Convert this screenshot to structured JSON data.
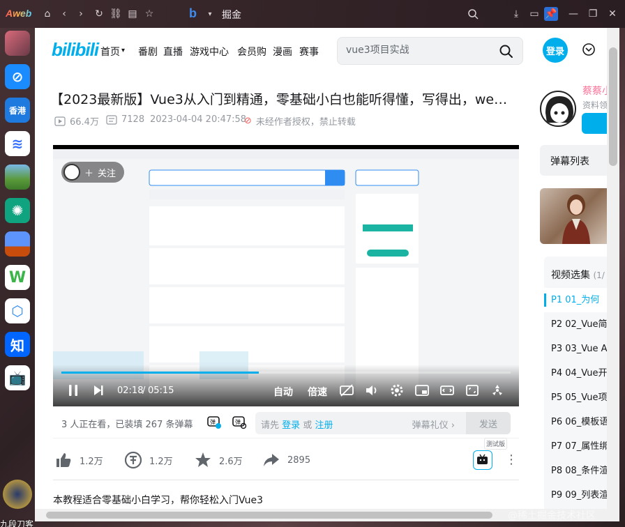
{
  "browser": {
    "brand": "Aweb",
    "tab_title": "掘金",
    "watermark": "@稀土掘金技术社区"
  },
  "dock": {
    "apps": [
      "photo",
      "safari",
      "香港",
      "lark",
      "landscape",
      "chatgpt",
      "mario",
      "W",
      "cube",
      "知",
      "bilibili-tv"
    ],
    "caption": "九段刀客"
  },
  "header": {
    "logo": "bilibili",
    "nav": [
      "首页",
      "番剧",
      "直播",
      "游戏中心",
      "会员购",
      "漫画",
      "赛事"
    ],
    "search_value": "vue3项目实战",
    "login_label": "登录"
  },
  "video": {
    "title": "【2023最新版】Vue3从入门到精通，零基础小白也能听得懂，写得出，we…",
    "views": "66.4万",
    "danmaku_count": "7128",
    "date": "2023-04-04 20:47:58",
    "copyright_notice": "未经作者授权，禁止转载",
    "description": "本教程适合零基础小白学习，帮你轻松入门Vue3"
  },
  "player": {
    "follow_label": "关注",
    "time_current": "02:18",
    "time_separator": "/",
    "time_total": "05:15",
    "progress_fraction": 0.44,
    "auto_label": "自动",
    "speed_label": "倍速"
  },
  "danmaku_bar": {
    "watching": "3 人正在看，已装填 267 条弹幕",
    "hint_prefix": "请先",
    "hint_login": "登录",
    "hint_or": "或",
    "hint_register": "注册",
    "etiquette": "弹幕礼仪 ›",
    "send": "发送"
  },
  "actions": {
    "like": "1.2万",
    "coin": "1.2万",
    "favorite": "2.6万",
    "share": "2895",
    "beta_tag": "测试版"
  },
  "sidebar": {
    "up_name": "蔡蔡小",
    "up_sub": "资料领",
    "danmaku_list": "弹幕列表",
    "playlist_title": "视频选集",
    "playlist_count": "(1/",
    "episodes": [
      "P1  01_为何",
      "P2  02_Vue简",
      "P3  03_Vue A",
      "P4  04_Vue开",
      "P5  05_Vue项",
      "P6  06_模板语",
      "P7  07_属性绑",
      "P8  08_条件渲",
      "P9  09_列表渲"
    ]
  },
  "colors": {
    "accent": "#00aeec",
    "pink": "#fb7299",
    "text": "#18191c",
    "muted": "#9499a0"
  }
}
